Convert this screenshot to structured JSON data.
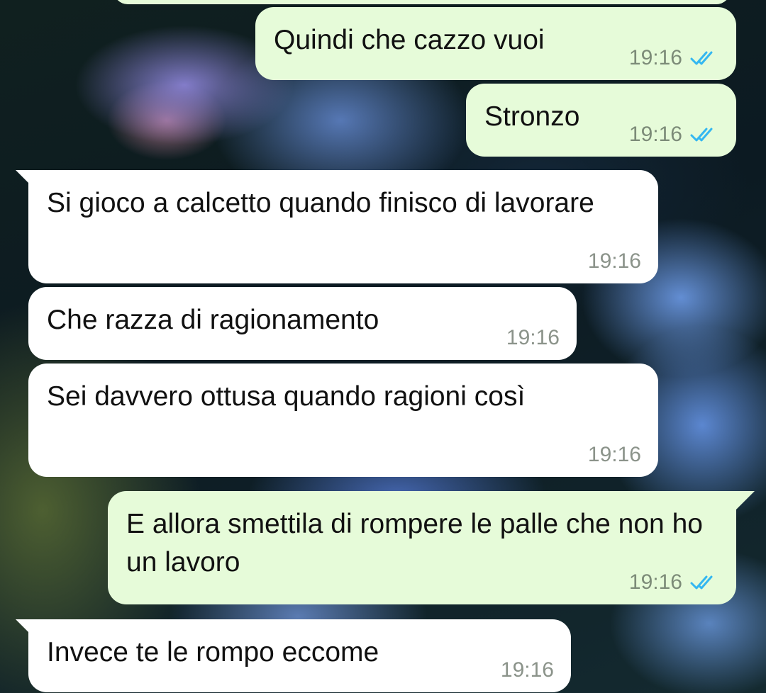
{
  "chat": {
    "messages": [
      {
        "direction": "out",
        "text": "Quindi che cazzo vuoi",
        "time": "19:16",
        "status": "read"
      },
      {
        "direction": "out",
        "text": "Stronzo",
        "time": "19:16",
        "status": "read"
      },
      {
        "direction": "in",
        "text": "Si gioco a calcetto quando finisco di lavorare",
        "time": "19:16"
      },
      {
        "direction": "in",
        "text": "Che razza di ragionamento",
        "time": "19:16"
      },
      {
        "direction": "in",
        "text": "Sei davvero ottusa quando ragioni così",
        "time": "19:16"
      },
      {
        "direction": "out",
        "text": "E allora smettila di rompere le palle che non ho un lavoro",
        "time": "19:16",
        "status": "read"
      },
      {
        "direction": "in",
        "text": "Invece te le rompo eccome",
        "time": "19:16"
      }
    ]
  },
  "colors": {
    "outgoing_bubble": "#e6fbd9",
    "incoming_bubble": "#ffffff",
    "read_ticks": "#34b7f1"
  },
  "icons": {
    "read_receipt": "double-check-icon"
  }
}
